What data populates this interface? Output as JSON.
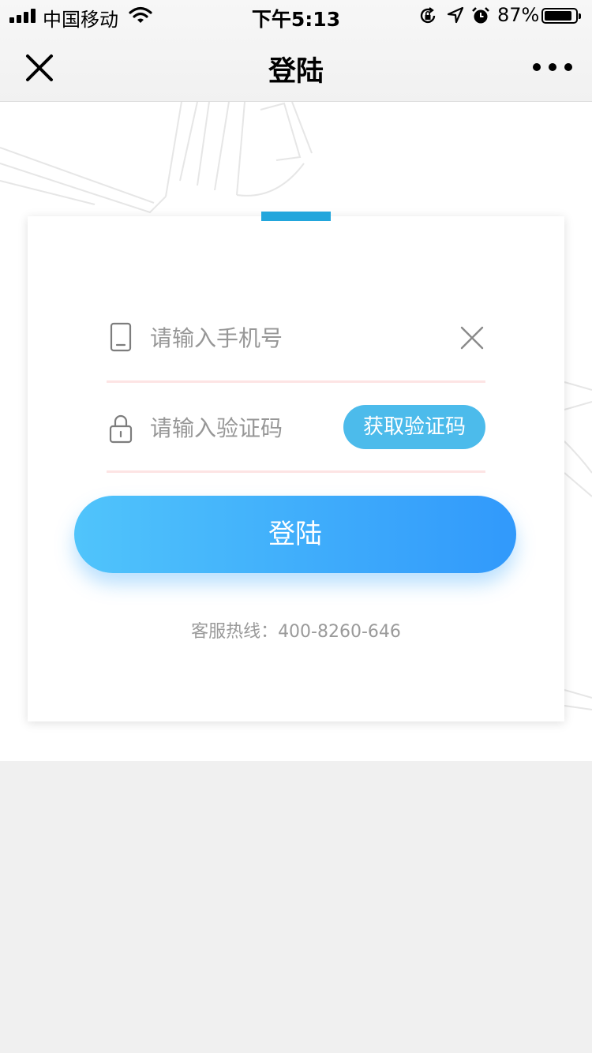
{
  "status_bar": {
    "carrier": "中国移动",
    "time": "下午5:13",
    "battery_percent": "87%",
    "battery_level": 0.87,
    "icons": [
      "signal-icon",
      "wifi-icon",
      "orientation-lock-icon",
      "location-icon",
      "alarm-icon",
      "battery-icon"
    ]
  },
  "nav": {
    "title": "登陆",
    "close_icon": "close-icon",
    "more_icon": "more-icon"
  },
  "form": {
    "phone": {
      "placeholder": "请输入手机号",
      "value": "",
      "icon": "phone-icon",
      "clear_icon": "clear-icon"
    },
    "code": {
      "placeholder": "请输入验证码",
      "value": "",
      "icon": "lock-icon",
      "get_code_label": "获取验证码"
    },
    "login_label": "登陆",
    "hotline": "客服热线：400-8260-646"
  },
  "colors": {
    "accent": "#22a6dc",
    "code_button": "#4cbbeb",
    "login_gradient_start": "#50c4fb",
    "login_gradient_end": "#3199fb",
    "field_underline": "#fde4e4",
    "hotline_text": "#9a9a9a",
    "page_background": "#f0f0f0"
  }
}
